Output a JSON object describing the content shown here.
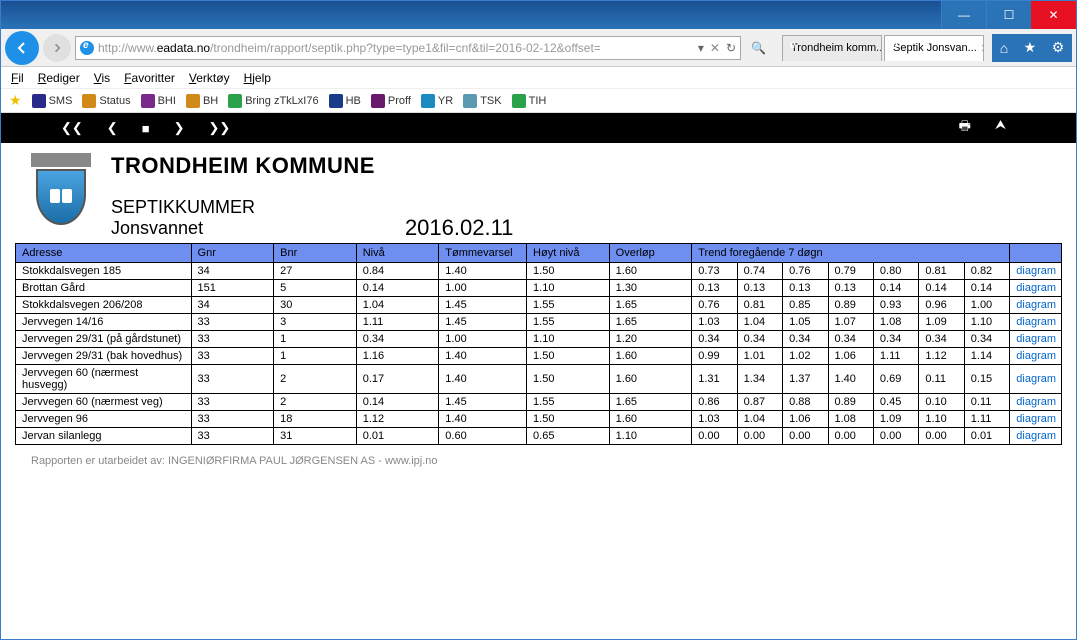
{
  "browser": {
    "url_proto": "http://",
    "url_prefix": "www.",
    "url_host": "eadata.no",
    "url_path": "/trondheim/rapport/septik.php?type=type1&fil=cnf&til=2016-02-12&offset=",
    "tabs": [
      {
        "label": "Trondheim komm...",
        "active": false
      },
      {
        "label": "Septik Jonsvan...",
        "active": true
      }
    ]
  },
  "menu": {
    "items": [
      "Fil",
      "Rediger",
      "Vis",
      "Favoritter",
      "Verktøy",
      "Hjelp"
    ]
  },
  "bookmarks": [
    {
      "label": "SMS",
      "color": "#2a2a8a"
    },
    {
      "label": "Status",
      "color": "#d08a1a"
    },
    {
      "label": "BHI",
      "color": "#7a2a8a"
    },
    {
      "label": "BH",
      "color": "#d08a1a"
    },
    {
      "label": "Bring zTkLxI76",
      "color": "#2aa24a"
    },
    {
      "label": "HB",
      "color": "#1a3a8a"
    },
    {
      "label": "Proff",
      "color": "#6a1a6a"
    },
    {
      "label": "YR",
      "color": "#1a8ac0"
    },
    {
      "label": "TSK",
      "color": "#5a9ab0"
    },
    {
      "label": "TIH",
      "color": "#2aa24a"
    }
  ],
  "report": {
    "municipality": "TRONDHEIM KOMMUNE",
    "title": "SEPTIKKUMMER",
    "location": "Jonsvannet",
    "date": "2016.02.11",
    "headers": {
      "adresse": "Adresse",
      "gnr": "Gnr",
      "bnr": "Bnr",
      "niva": "Nivå",
      "tommevarsel": "Tømmevarsel",
      "hoyt": "Høyt nivå",
      "overlop": "Overløp",
      "trend": "Trend foregående 7 døgn",
      "diagram": "diagram"
    },
    "rows": [
      {
        "adresse": "Stokkdalsvegen 185",
        "gnr": "34",
        "bnr": "27",
        "niva": "0.84",
        "tom": "1.40",
        "hoy": "1.50",
        "ovl": "1.60",
        "trend": [
          "0.73",
          "0.74",
          "0.76",
          "0.79",
          "0.80",
          "0.81",
          "0.82"
        ]
      },
      {
        "adresse": "Brottan Gård",
        "gnr": "151",
        "bnr": "5",
        "niva": "0.14",
        "tom": "1.00",
        "hoy": "1.10",
        "ovl": "1.30",
        "trend": [
          "0.13",
          "0.13",
          "0.13",
          "0.13",
          "0.14",
          "0.14",
          "0.14"
        ]
      },
      {
        "adresse": "Stokkdalsvegen 206/208",
        "gnr": "34",
        "bnr": "30",
        "niva": "1.04",
        "tom": "1.45",
        "hoy": "1.55",
        "ovl": "1.65",
        "trend": [
          "0.76",
          "0.81",
          "0.85",
          "0.89",
          "0.93",
          "0.96",
          "1.00"
        ]
      },
      {
        "adresse": "Jervvegen 14/16",
        "gnr": "33",
        "bnr": "3",
        "niva": "1.11",
        "tom": "1.45",
        "hoy": "1.55",
        "ovl": "1.65",
        "trend": [
          "1.03",
          "1.04",
          "1.05",
          "1.07",
          "1.08",
          "1.09",
          "1.10"
        ]
      },
      {
        "adresse": "Jervvegen 29/31 (på gårdstunet)",
        "gnr": "33",
        "bnr": "1",
        "niva": "0.34",
        "tom": "1.00",
        "hoy": "1.10",
        "ovl": "1.20",
        "trend": [
          "0.34",
          "0.34",
          "0.34",
          "0.34",
          "0.34",
          "0.34",
          "0.34"
        ]
      },
      {
        "adresse": "Jervvegen 29/31 (bak hovedhus)",
        "gnr": "33",
        "bnr": "1",
        "niva": "1.16",
        "tom": "1.40",
        "hoy": "1.50",
        "ovl": "1.60",
        "trend": [
          "0.99",
          "1.01",
          "1.02",
          "1.06",
          "1.11",
          "1.12",
          "1.14"
        ]
      },
      {
        "adresse": "Jervvegen 60 (nærmest husvegg)",
        "gnr": "33",
        "bnr": "2",
        "niva": "0.17",
        "tom": "1.40",
        "hoy": "1.50",
        "ovl": "1.60",
        "trend": [
          "1.31",
          "1.34",
          "1.37",
          "1.40",
          "0.69",
          "0.11",
          "0.15"
        ]
      },
      {
        "adresse": "Jervvegen 60 (nærmest veg)",
        "gnr": "33",
        "bnr": "2",
        "niva": "0.14",
        "tom": "1.45",
        "hoy": "1.55",
        "ovl": "1.65",
        "trend": [
          "0.86",
          "0.87",
          "0.88",
          "0.89",
          "0.45",
          "0.10",
          "0.11"
        ]
      },
      {
        "adresse": "Jervvegen 96",
        "gnr": "33",
        "bnr": "18",
        "niva": "1.12",
        "tom": "1.40",
        "hoy": "1.50",
        "ovl": "1.60",
        "trend": [
          "1.03",
          "1.04",
          "1.06",
          "1.08",
          "1.09",
          "1.10",
          "1.11"
        ]
      },
      {
        "adresse": "Jervan silanlegg",
        "gnr": "33",
        "bnr": "31",
        "niva": "0.01",
        "tom": "0.60",
        "hoy": "0.65",
        "ovl": "1.10",
        "trend": [
          "0.00",
          "0.00",
          "0.00",
          "0.00",
          "0.00",
          "0.00",
          "0.01"
        ]
      }
    ],
    "footer": "Rapporten er utarbeidet av: INGENIØRFIRMA PAUL JØRGENSEN AS  - www.ipj.no"
  }
}
